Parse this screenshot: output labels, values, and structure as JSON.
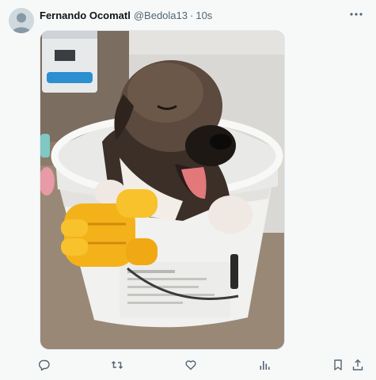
{
  "post": {
    "author": {
      "display_name": "Fernando Ocomatl",
      "handle": "@Bedola13",
      "separator": "·",
      "time": "10s"
    },
    "media": {
      "icon": "dog-in-bucket-photo"
    },
    "actions": [
      {
        "name": "reply",
        "icon": "reply-icon"
      },
      {
        "name": "repost",
        "icon": "repost-icon"
      },
      {
        "name": "like",
        "icon": "like-icon"
      },
      {
        "name": "views",
        "icon": "views-icon"
      },
      {
        "name": "bookmark",
        "icon": "bookmark-icon"
      },
      {
        "name": "share",
        "icon": "share-icon"
      }
    ],
    "colors": {
      "icon_gray": "#536471",
      "text_dark": "#0f1419",
      "background": "#f7f9f9"
    }
  }
}
